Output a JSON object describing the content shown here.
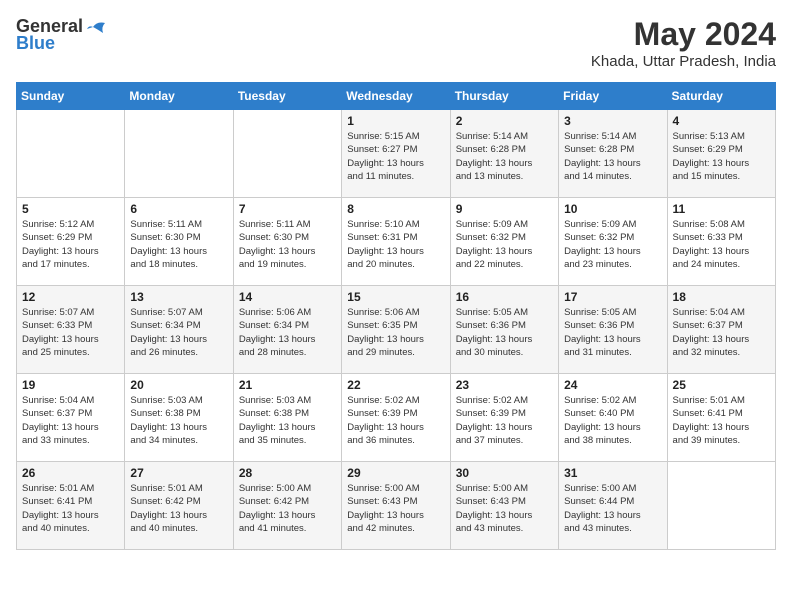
{
  "header": {
    "logo_general": "General",
    "logo_blue": "Blue",
    "month_year": "May 2024",
    "location": "Khada, Uttar Pradesh, India"
  },
  "weekdays": [
    "Sunday",
    "Monday",
    "Tuesday",
    "Wednesday",
    "Thursday",
    "Friday",
    "Saturday"
  ],
  "weeks": [
    [
      {
        "day": "",
        "info": ""
      },
      {
        "day": "",
        "info": ""
      },
      {
        "day": "",
        "info": ""
      },
      {
        "day": "1",
        "info": "Sunrise: 5:15 AM\nSunset: 6:27 PM\nDaylight: 13 hours\nand 11 minutes."
      },
      {
        "day": "2",
        "info": "Sunrise: 5:14 AM\nSunset: 6:28 PM\nDaylight: 13 hours\nand 13 minutes."
      },
      {
        "day": "3",
        "info": "Sunrise: 5:14 AM\nSunset: 6:28 PM\nDaylight: 13 hours\nand 14 minutes."
      },
      {
        "day": "4",
        "info": "Sunrise: 5:13 AM\nSunset: 6:29 PM\nDaylight: 13 hours\nand 15 minutes."
      }
    ],
    [
      {
        "day": "5",
        "info": "Sunrise: 5:12 AM\nSunset: 6:29 PM\nDaylight: 13 hours\nand 17 minutes."
      },
      {
        "day": "6",
        "info": "Sunrise: 5:11 AM\nSunset: 6:30 PM\nDaylight: 13 hours\nand 18 minutes."
      },
      {
        "day": "7",
        "info": "Sunrise: 5:11 AM\nSunset: 6:30 PM\nDaylight: 13 hours\nand 19 minutes."
      },
      {
        "day": "8",
        "info": "Sunrise: 5:10 AM\nSunset: 6:31 PM\nDaylight: 13 hours\nand 20 minutes."
      },
      {
        "day": "9",
        "info": "Sunrise: 5:09 AM\nSunset: 6:32 PM\nDaylight: 13 hours\nand 22 minutes."
      },
      {
        "day": "10",
        "info": "Sunrise: 5:09 AM\nSunset: 6:32 PM\nDaylight: 13 hours\nand 23 minutes."
      },
      {
        "day": "11",
        "info": "Sunrise: 5:08 AM\nSunset: 6:33 PM\nDaylight: 13 hours\nand 24 minutes."
      }
    ],
    [
      {
        "day": "12",
        "info": "Sunrise: 5:07 AM\nSunset: 6:33 PM\nDaylight: 13 hours\nand 25 minutes."
      },
      {
        "day": "13",
        "info": "Sunrise: 5:07 AM\nSunset: 6:34 PM\nDaylight: 13 hours\nand 26 minutes."
      },
      {
        "day": "14",
        "info": "Sunrise: 5:06 AM\nSunset: 6:34 PM\nDaylight: 13 hours\nand 28 minutes."
      },
      {
        "day": "15",
        "info": "Sunrise: 5:06 AM\nSunset: 6:35 PM\nDaylight: 13 hours\nand 29 minutes."
      },
      {
        "day": "16",
        "info": "Sunrise: 5:05 AM\nSunset: 6:36 PM\nDaylight: 13 hours\nand 30 minutes."
      },
      {
        "day": "17",
        "info": "Sunrise: 5:05 AM\nSunset: 6:36 PM\nDaylight: 13 hours\nand 31 minutes."
      },
      {
        "day": "18",
        "info": "Sunrise: 5:04 AM\nSunset: 6:37 PM\nDaylight: 13 hours\nand 32 minutes."
      }
    ],
    [
      {
        "day": "19",
        "info": "Sunrise: 5:04 AM\nSunset: 6:37 PM\nDaylight: 13 hours\nand 33 minutes."
      },
      {
        "day": "20",
        "info": "Sunrise: 5:03 AM\nSunset: 6:38 PM\nDaylight: 13 hours\nand 34 minutes."
      },
      {
        "day": "21",
        "info": "Sunrise: 5:03 AM\nSunset: 6:38 PM\nDaylight: 13 hours\nand 35 minutes."
      },
      {
        "day": "22",
        "info": "Sunrise: 5:02 AM\nSunset: 6:39 PM\nDaylight: 13 hours\nand 36 minutes."
      },
      {
        "day": "23",
        "info": "Sunrise: 5:02 AM\nSunset: 6:39 PM\nDaylight: 13 hours\nand 37 minutes."
      },
      {
        "day": "24",
        "info": "Sunrise: 5:02 AM\nSunset: 6:40 PM\nDaylight: 13 hours\nand 38 minutes."
      },
      {
        "day": "25",
        "info": "Sunrise: 5:01 AM\nSunset: 6:41 PM\nDaylight: 13 hours\nand 39 minutes."
      }
    ],
    [
      {
        "day": "26",
        "info": "Sunrise: 5:01 AM\nSunset: 6:41 PM\nDaylight: 13 hours\nand 40 minutes."
      },
      {
        "day": "27",
        "info": "Sunrise: 5:01 AM\nSunset: 6:42 PM\nDaylight: 13 hours\nand 40 minutes."
      },
      {
        "day": "28",
        "info": "Sunrise: 5:00 AM\nSunset: 6:42 PM\nDaylight: 13 hours\nand 41 minutes."
      },
      {
        "day": "29",
        "info": "Sunrise: 5:00 AM\nSunset: 6:43 PM\nDaylight: 13 hours\nand 42 minutes."
      },
      {
        "day": "30",
        "info": "Sunrise: 5:00 AM\nSunset: 6:43 PM\nDaylight: 13 hours\nand 43 minutes."
      },
      {
        "day": "31",
        "info": "Sunrise: 5:00 AM\nSunset: 6:44 PM\nDaylight: 13 hours\nand 43 minutes."
      },
      {
        "day": "",
        "info": ""
      }
    ]
  ]
}
